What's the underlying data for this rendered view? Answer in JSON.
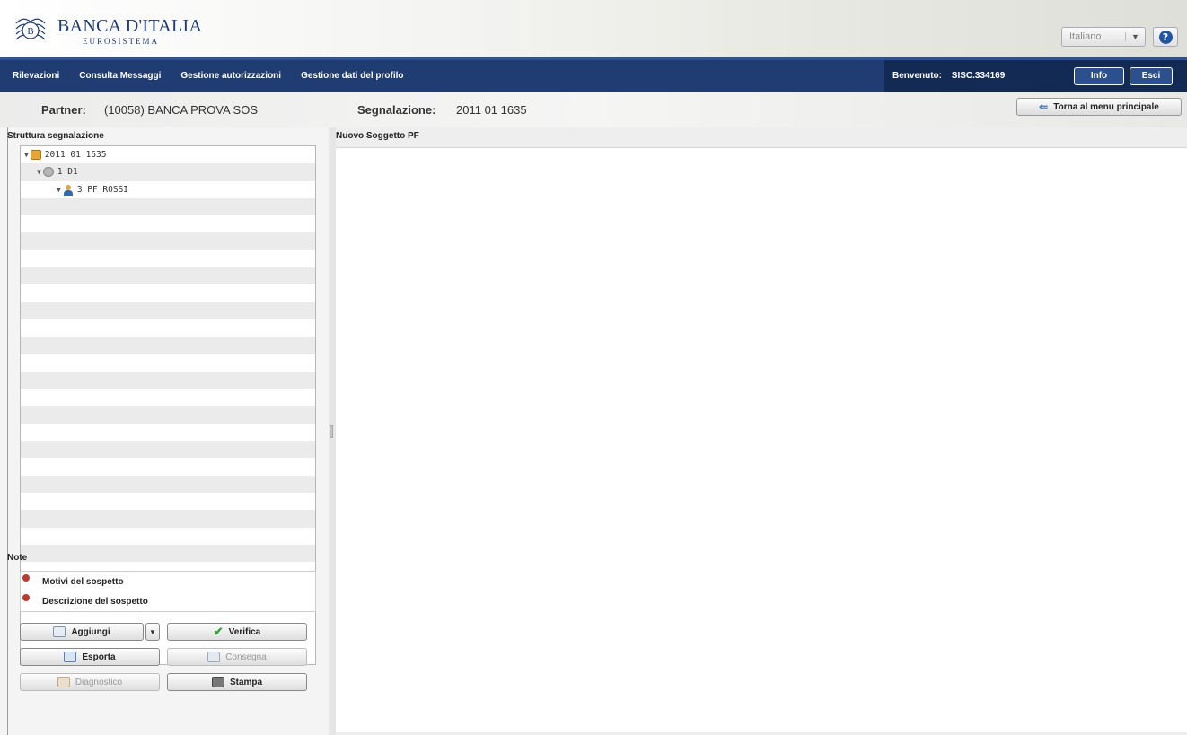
{
  "header": {
    "logo_title": "BANCA D'ITALIA",
    "logo_subtitle": "EUROSISTEMA",
    "language": "Italiano",
    "help_symbol": "?"
  },
  "nav": {
    "items": [
      "Rilevazioni",
      "Consulta Messaggi",
      "Gestione autorizzazioni",
      "Gestione dati del profilo"
    ],
    "welcome_label": "Benvenuto:",
    "user_id": "SISC.334169",
    "info_label": "Info",
    "esci_label": "Esci"
  },
  "partner": {
    "partner_label": "Partner:",
    "partner_value": "(10058) BANCA PROVA SOS",
    "segnalazione_label": "Segnalazione:",
    "segnalazione_value": "2011 01 1635",
    "back_label": "Torna al menu principale"
  },
  "structure": {
    "title": "Struttura segnalazione",
    "tree": [
      {
        "label": "2011 01 1635",
        "icon": "folder-icon",
        "level": 0
      },
      {
        "label": "1 D1",
        "icon": "gear-icon",
        "level": 1
      },
      {
        "label": "3  PF ROSSI",
        "icon": "person-icon",
        "level": 2
      }
    ]
  },
  "notes": {
    "title": "Note",
    "items": [
      "Motivi del sospetto",
      "Descrizione del sospetto"
    ]
  },
  "actions": {
    "aggiungi": "Aggiungi",
    "verifica": "Verifica",
    "esporta": "Esporta",
    "consegna": "Consegna",
    "diagnostico": "Diagnostico",
    "stampa": "Stampa"
  },
  "main": {
    "title": "Nuovo Soggetto PF"
  }
}
